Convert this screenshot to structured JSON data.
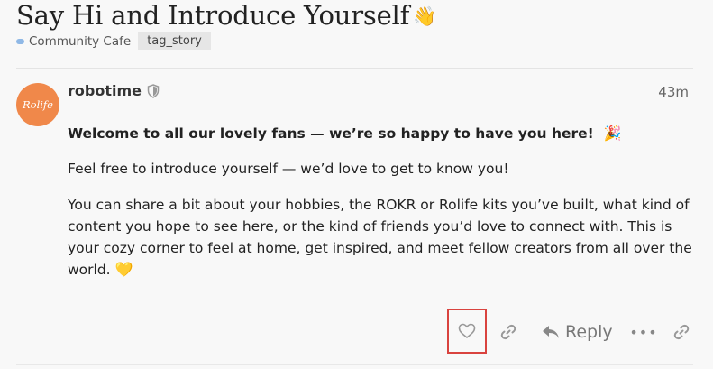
{
  "topic": {
    "title": "Say Hi and Introduce Yourself",
    "title_emoji": "👋",
    "category": "Community Cafe",
    "tag": "tag_story"
  },
  "post": {
    "author": "robotime",
    "avatar_text": "Rolife",
    "time": "43m",
    "intro": "Welcome to all our lovely fans — we’re so happy to have you here!",
    "intro_emoji": "🎉",
    "paragraph_1": "Feel free to introduce yourself — we’d love to get to know you!",
    "paragraph_2": "You can share a bit about your hobbies, the ROKR or Rolife kits you’ve built, what kind of content you hope to see here, or the kind of friends you’d love to connect with. This is your cozy corner to feel at home, get inspired, and meet fellow creators from all over the world.",
    "paragraph_2_emoji": "💛"
  },
  "actions": {
    "reply_label": "Reply",
    "more_label": "•••"
  },
  "colors": {
    "avatar_bg": "#f0884a",
    "highlight": "#d9433f",
    "category_dot": "#8fb8e6"
  },
  "icons": {
    "like": "heart-icon",
    "copy_link": "link-icon",
    "reply": "reply-arrow-icon",
    "more": "ellipsis-icon",
    "share": "link-icon",
    "moderator": "shield-icon"
  }
}
